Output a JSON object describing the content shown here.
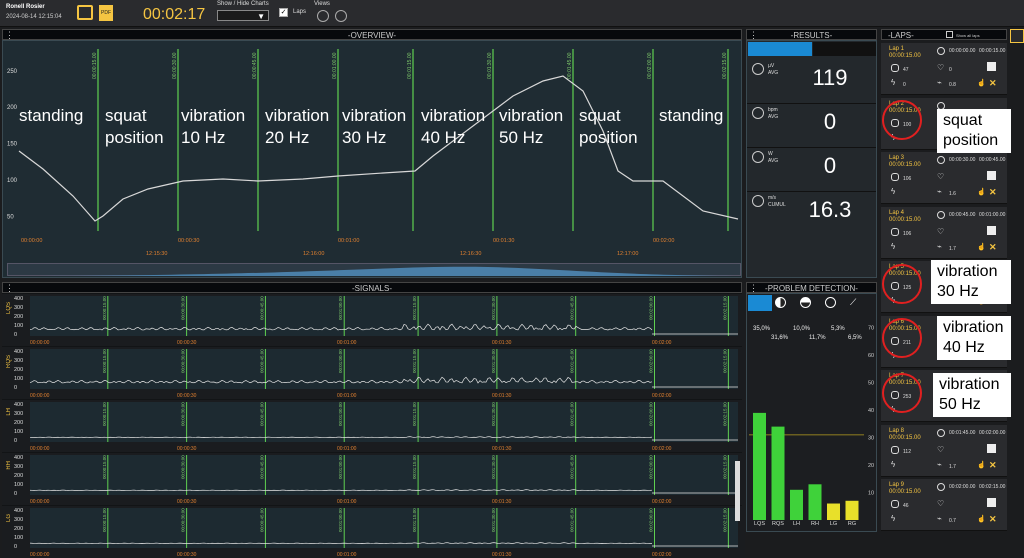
{
  "header": {
    "user": "Ronell Rosier",
    "datetime": "2024-08-14 12:15:04",
    "pdf": "PDF",
    "timer": "00:02:17",
    "show_hide": "Show / Hide Charts",
    "laps_label": "Laps",
    "views": "Views"
  },
  "overview": {
    "title": "-OVERVIEW-",
    "yticks": [
      "250",
      "200",
      "150",
      "100",
      "50"
    ],
    "xticks_top": [
      "00:00:00",
      "00:00:30",
      "00:01:00",
      "00:01:30",
      "00:02:00"
    ],
    "xticks_bottom": [
      "12:15:30",
      "12:16:00",
      "12:16:30",
      "12:17:00"
    ],
    "markers": [
      "00:00:15.00",
      "00:00:30.00",
      "00:00:45.00",
      "00:01:00.00",
      "00:01:15.00",
      "00:01:30.00",
      "00:01:45.00",
      "00:02:00.00",
      "00:02:15.00"
    ],
    "annotations": [
      "standing",
      "squat position",
      "vibration 10 Hz",
      "vibration 20 Hz",
      "vibration 30 Hz",
      "vibration 40 Hz",
      "vibration 50 Hz",
      "squat position",
      "standing"
    ]
  },
  "results": {
    "title": "-RESULTS-",
    "rows": [
      {
        "unit": "µV",
        "agg": "AVG",
        "value": "119"
      },
      {
        "unit": "bpm",
        "agg": "AVG",
        "value": "0"
      },
      {
        "unit": "W",
        "agg": "AVG",
        "value": "0"
      },
      {
        "unit": "m/s",
        "agg": "CUMUL",
        "value": "16.3"
      }
    ]
  },
  "signals": {
    "title": "-SIGNALS-",
    "channels": [
      "LQS",
      "RQS",
      "LH",
      "RH",
      "LG"
    ],
    "yticks": [
      "400",
      "300",
      "200",
      "100",
      "0"
    ],
    "xticks": [
      "00:00:00",
      "00:00:30",
      "00:01:00",
      "00:01:30",
      "00:02:00"
    ]
  },
  "problem": {
    "title": "-PROBLEM DETECTION-",
    "pcts_row1": [
      "35,0%",
      "10,0%",
      "5,3%"
    ],
    "pcts_row2": [
      "31,6%",
      "11,7%",
      "6,5%"
    ],
    "yticks": [
      "70",
      "60",
      "50",
      "40",
      "30",
      "20",
      "10"
    ],
    "bars": [
      {
        "label": "LQS",
        "value": 39,
        "color": "#3fd23a"
      },
      {
        "label": "RQS",
        "value": 34,
        "color": "#3fd23a"
      },
      {
        "label": "LH",
        "value": 11,
        "color": "#3fd23a"
      },
      {
        "label": "RH",
        "value": 13,
        "color": "#3fd23a"
      },
      {
        "label": "LG",
        "value": 6,
        "color": "#e8e02a"
      },
      {
        "label": "RG",
        "value": 7,
        "color": "#e8e02a"
      }
    ]
  },
  "laps": {
    "title": "-LAPS-",
    "show_all": "Show all laps",
    "items": [
      {
        "name": "Lap 1",
        "dur": "00:00:15.00",
        "start": "00:00:00.00",
        "end": "00:00:15.00",
        "v1": "47",
        "v2": "0",
        "v3": "0",
        "v4": "0.8"
      },
      {
        "name": "Lap 2",
        "dur": "00:00:15.00",
        "start": "",
        "end": "",
        "v1": "100",
        "v2": "",
        "v3": "",
        "v4": ""
      },
      {
        "name": "Lap 3",
        "dur": "00:00:15.00",
        "start": "00:00:30.00",
        "end": "00:00:45.00",
        "v1": "106",
        "v2": "",
        "v3": "",
        "v4": "1.6"
      },
      {
        "name": "Lap 4",
        "dur": "00:00:15.00",
        "start": "00:00:45.00",
        "end": "00:01:00.00",
        "v1": "106",
        "v2": "",
        "v3": "",
        "v4": "1.7"
      },
      {
        "name": "Lap 5",
        "dur": "00:00:15.00",
        "start": "",
        "end": "",
        "v1": "125",
        "v2": "",
        "v3": "",
        "v4": ""
      },
      {
        "name": "Lap 6",
        "dur": "00:00:15.00",
        "start": "",
        "end": "",
        "v1": "211",
        "v2": "",
        "v3": "",
        "v4": ""
      },
      {
        "name": "Lap 7",
        "dur": "00:00:15.00",
        "start": "",
        "end": "",
        "v1": "253",
        "v2": "",
        "v3": "",
        "v4": ""
      },
      {
        "name": "Lap 8",
        "dur": "00:00:15.00",
        "start": "00:01:45.00",
        "end": "00:02:00.00",
        "v1": "112",
        "v2": "",
        "v3": "",
        "v4": "1.7"
      },
      {
        "name": "Lap 9",
        "dur": "00:00:15.00",
        "start": "00:02:00.00",
        "end": "00:02:15.00",
        "v1": "46",
        "v2": "",
        "v3": "",
        "v4": "0.7"
      }
    ],
    "callouts": [
      "squat position",
      "vibration 30 Hz",
      "vibration 40 Hz",
      "vibration 50 Hz"
    ]
  },
  "colors": {
    "accent": "#f5c542",
    "marker": "#5fd050",
    "annot": "#ffffff"
  }
}
